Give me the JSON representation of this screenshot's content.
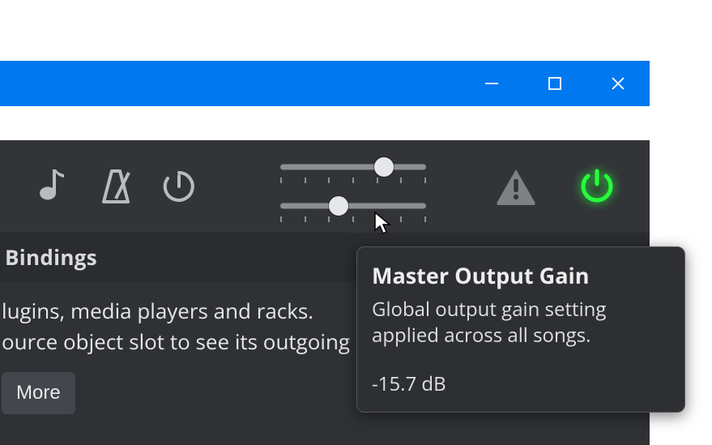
{
  "window_controls": {
    "minimize": "minimize",
    "maximize": "maximize",
    "close": "close"
  },
  "toolbar": {
    "icons": {
      "tempo": "music-note-icon",
      "metronome": "metronome-icon",
      "timer": "stopwatch-icon",
      "warning": "warning-icon",
      "power": "power-icon"
    },
    "slider_top": {
      "position_pct": 71
    },
    "slider_bottom": {
      "position_pct": 40
    }
  },
  "tabs": {
    "bindings_label": "Bindings"
  },
  "content": {
    "line1": "lugins, media players and racks.",
    "line2": "ource object slot to see its outgoing rou",
    "more_label": "More"
  },
  "tooltip": {
    "title": "Master Output Gain",
    "description": "Global output gain setting applied across all songs.",
    "value": "-15.7 dB"
  }
}
